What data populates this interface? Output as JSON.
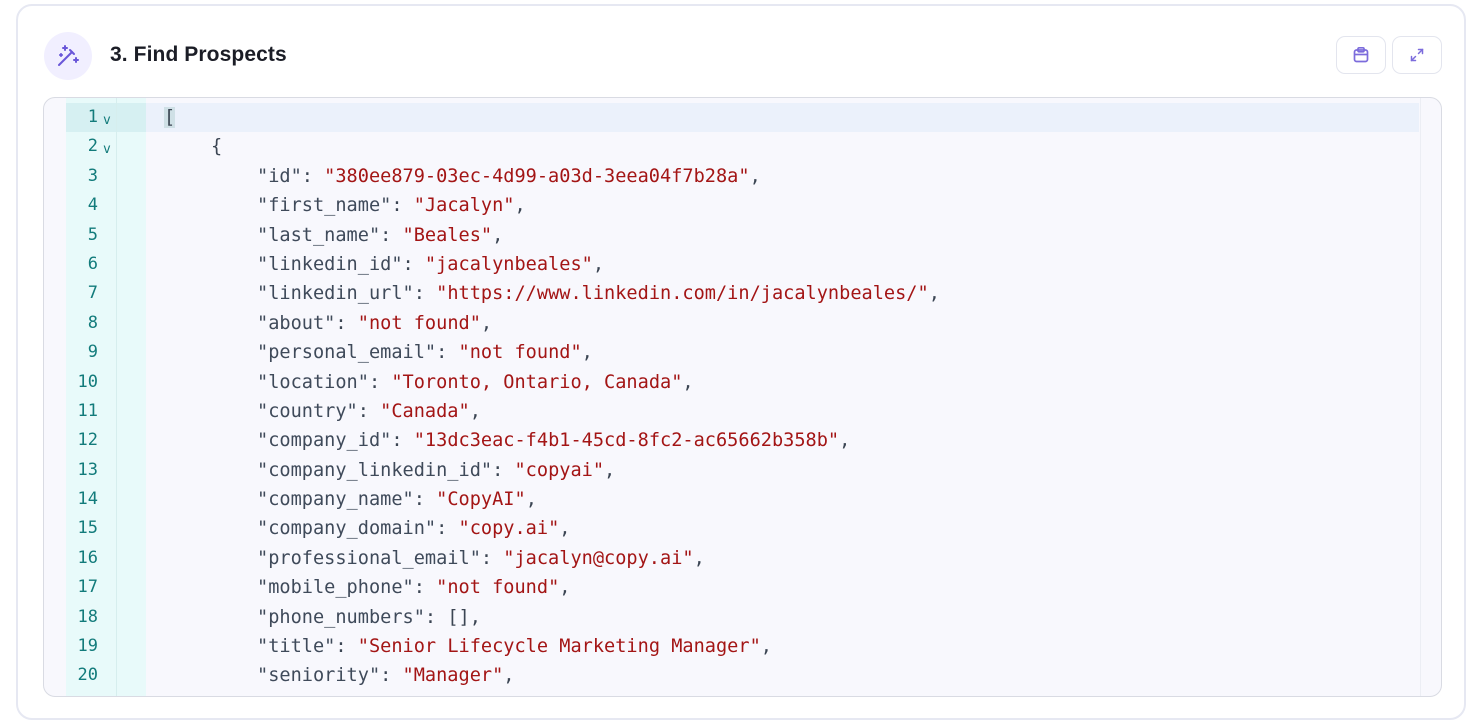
{
  "header": {
    "icon": "magic-wand-icon",
    "title": "3. Find Prospects",
    "copy_icon": "clipboard-icon",
    "expand_icon": "expand-icon"
  },
  "colors": {
    "accent": "#7c6cdc",
    "line_number": "#127b7b",
    "string": "#a31515",
    "key": "#3f4a5a",
    "gutter_bg": "#e8fafa"
  },
  "editor": {
    "lines": [
      {
        "n": "1",
        "fold": "v",
        "indent": 0,
        "text": "["
      },
      {
        "n": "2",
        "fold": "v",
        "indent": 1,
        "text": "{"
      },
      {
        "n": "3",
        "indent": 2,
        "key": "\"id\"",
        "value": "\"380ee879-03ec-4d99-a03d-3eea04f7b28a\"",
        "tail": ","
      },
      {
        "n": "4",
        "indent": 2,
        "key": "\"first_name\"",
        "value": "\"Jacalyn\"",
        "tail": ","
      },
      {
        "n": "5",
        "indent": 2,
        "key": "\"last_name\"",
        "value": "\"Beales\"",
        "tail": ","
      },
      {
        "n": "6",
        "indent": 2,
        "key": "\"linkedin_id\"",
        "value": "\"jacalynbeales\"",
        "tail": ","
      },
      {
        "n": "7",
        "indent": 2,
        "key": "\"linkedin_url\"",
        "value": "\"https://www.linkedin.com/in/jacalynbeales/\"",
        "tail": ","
      },
      {
        "n": "8",
        "indent": 2,
        "key": "\"about\"",
        "value": "\"not found\"",
        "tail": ","
      },
      {
        "n": "9",
        "indent": 2,
        "key": "\"personal_email\"",
        "value": "\"not found\"",
        "tail": ","
      },
      {
        "n": "10",
        "indent": 2,
        "key": "\"location\"",
        "value": "\"Toronto, Ontario, Canada\"",
        "tail": ","
      },
      {
        "n": "11",
        "indent": 2,
        "key": "\"country\"",
        "value": "\"Canada\"",
        "tail": ","
      },
      {
        "n": "12",
        "indent": 2,
        "key": "\"company_id\"",
        "value": "\"13dc3eac-f4b1-45cd-8fc2-ac65662b358b\"",
        "tail": ","
      },
      {
        "n": "13",
        "indent": 2,
        "key": "\"company_linkedin_id\"",
        "value": "\"copyai\"",
        "tail": ","
      },
      {
        "n": "14",
        "indent": 2,
        "key": "\"company_name\"",
        "value": "\"CopyAI\"",
        "tail": ","
      },
      {
        "n": "15",
        "indent": 2,
        "key": "\"company_domain\"",
        "value": "\"copy.ai\"",
        "tail": ","
      },
      {
        "n": "16",
        "indent": 2,
        "key": "\"professional_email\"",
        "value": "\"jacalyn@copy.ai\"",
        "tail": ","
      },
      {
        "n": "17",
        "indent": 2,
        "key": "\"mobile_phone\"",
        "value": "\"not found\"",
        "tail": ","
      },
      {
        "n": "18",
        "indent": 2,
        "key": "\"phone_numbers\"",
        "raw": "[]",
        "tail": ","
      },
      {
        "n": "19",
        "indent": 2,
        "key": "\"title\"",
        "value": "\"Senior Lifecycle Marketing Manager\"",
        "tail": ","
      },
      {
        "n": "20",
        "indent": 2,
        "key": "\"seniority\"",
        "value": "\"Manager\"",
        "tail": ","
      }
    ]
  }
}
